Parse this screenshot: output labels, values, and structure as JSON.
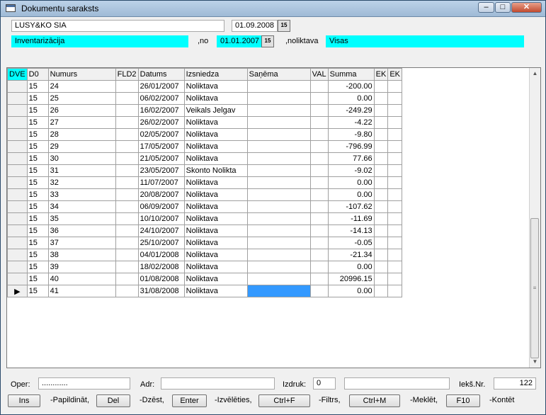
{
  "window": {
    "title": "Dokumentu saraksts",
    "minimize": "–",
    "maximize": "□",
    "close": "✕"
  },
  "header": {
    "company": "LUSY&KO SIA",
    "date": "01.09.2008",
    "doc_type": "Inventarizācija",
    "from_label": ",no",
    "from_date": "01.01.2007",
    "warehouse_label": ",noliktava",
    "warehouse": "Visas",
    "calendar_icon": "15"
  },
  "grid": {
    "columns": [
      "DVE",
      "D0",
      "Numurs",
      "FLD2",
      "Datums",
      "Izsniedza",
      "Saņēma",
      "VAL",
      "Summa",
      "EK",
      "EK"
    ],
    "rows": [
      {
        "marker": "",
        "d0": "15",
        "numurs": "24",
        "fld2": "",
        "datums": "26/01/2007",
        "izsniedza": "Noliktava",
        "sanema": "",
        "val": "",
        "summa": "-200.00"
      },
      {
        "marker": "",
        "d0": "15",
        "numurs": "25",
        "fld2": "",
        "datums": "06/02/2007",
        "izsniedza": "Noliktava",
        "sanema": "",
        "val": "",
        "summa": "0.00"
      },
      {
        "marker": "",
        "d0": "15",
        "numurs": "26",
        "fld2": "",
        "datums": "16/02/2007",
        "izsniedza": "Veikals Jelgav",
        "sanema": "",
        "val": "",
        "summa": "-249.29"
      },
      {
        "marker": "",
        "d0": "15",
        "numurs": "27",
        "fld2": "",
        "datums": "26/02/2007",
        "izsniedza": "Noliktava",
        "sanema": "",
        "val": "",
        "summa": "-4.22"
      },
      {
        "marker": "",
        "d0": "15",
        "numurs": "28",
        "fld2": "",
        "datums": "02/05/2007",
        "izsniedza": "Noliktava",
        "sanema": "",
        "val": "",
        "summa": "-9.80"
      },
      {
        "marker": "",
        "d0": "15",
        "numurs": "29",
        "fld2": "",
        "datums": "17/05/2007",
        "izsniedza": "Noliktava",
        "sanema": "",
        "val": "",
        "summa": "-796.99"
      },
      {
        "marker": "",
        "d0": "15",
        "numurs": "30",
        "fld2": "",
        "datums": "21/05/2007",
        "izsniedza": "Noliktava",
        "sanema": "",
        "val": "",
        "summa": "77.66"
      },
      {
        "marker": "",
        "d0": "15",
        "numurs": "31",
        "fld2": "",
        "datums": "23/05/2007",
        "izsniedza": "Skonto Nolikta",
        "sanema": "",
        "val": "",
        "summa": "-9.02"
      },
      {
        "marker": "",
        "d0": "15",
        "numurs": "32",
        "fld2": "",
        "datums": "11/07/2007",
        "izsniedza": "Noliktava",
        "sanema": "",
        "val": "",
        "summa": "0.00"
      },
      {
        "marker": "",
        "d0": "15",
        "numurs": "33",
        "fld2": "",
        "datums": "20/08/2007",
        "izsniedza": "Noliktava",
        "sanema": "",
        "val": "",
        "summa": "0.00"
      },
      {
        "marker": "",
        "d0": "15",
        "numurs": "34",
        "fld2": "",
        "datums": "06/09/2007",
        "izsniedza": "Noliktava",
        "sanema": "",
        "val": "",
        "summa": "-107.62"
      },
      {
        "marker": "",
        "d0": "15",
        "numurs": "35",
        "fld2": "",
        "datums": "10/10/2007",
        "izsniedza": "Noliktava",
        "sanema": "",
        "val": "",
        "summa": "-11.69"
      },
      {
        "marker": "",
        "d0": "15",
        "numurs": "36",
        "fld2": "",
        "datums": "24/10/2007",
        "izsniedza": "Noliktava",
        "sanema": "",
        "val": "",
        "summa": "-14.13"
      },
      {
        "marker": "",
        "d0": "15",
        "numurs": "37",
        "fld2": "",
        "datums": "25/10/2007",
        "izsniedza": "Noliktava",
        "sanema": "",
        "val": "",
        "summa": "-0.05"
      },
      {
        "marker": "",
        "d0": "15",
        "numurs": "38",
        "fld2": "",
        "datums": "04/01/2008",
        "izsniedza": "Noliktava",
        "sanema": "",
        "val": "",
        "summa": "-21.34"
      },
      {
        "marker": "",
        "d0": "15",
        "numurs": "39",
        "fld2": "",
        "datums": "18/02/2008",
        "izsniedza": "Noliktava",
        "sanema": "",
        "val": "",
        "summa": "0.00"
      },
      {
        "marker": "",
        "d0": "15",
        "numurs": "40",
        "fld2": "",
        "datums": "01/08/2008",
        "izsniedza": "Noliktava",
        "sanema": "",
        "val": "",
        "summa": "20996.15"
      },
      {
        "marker": "▶",
        "d0": "15",
        "numurs": "41",
        "fld2": "",
        "datums": "31/08/2008",
        "izsniedza": "Noliktava",
        "sanema": "",
        "val": "",
        "summa": "0.00",
        "selected": true
      }
    ],
    "scroll_up": "▲",
    "scroll_down": "▼",
    "thumb_grip": "≡"
  },
  "footer": {
    "oper_label": "Oper:",
    "oper_value": "............",
    "adr_label": "Adr:",
    "adr_value": "",
    "izdruk_label": "Izdruk:",
    "izdruk_value": "0",
    "extra_value": "",
    "ieks_label": "Iekš.Nr.",
    "ieks_value": "122",
    "buttons": [
      {
        "key": "Ins",
        "desc": "-Papildināt,"
      },
      {
        "key": "Del",
        "desc": "-Dzēst,"
      },
      {
        "key": "Enter",
        "desc": "-Izvēlēties,"
      },
      {
        "key": "Ctrl+F",
        "desc": "-Filtrs,"
      },
      {
        "key": "Ctrl+M",
        "desc": "-Meklēt,"
      },
      {
        "key": "F10",
        "desc": "-Kontēt"
      }
    ]
  },
  "colors": {
    "highlight": "#00ffff",
    "selection": "#3399ff"
  }
}
